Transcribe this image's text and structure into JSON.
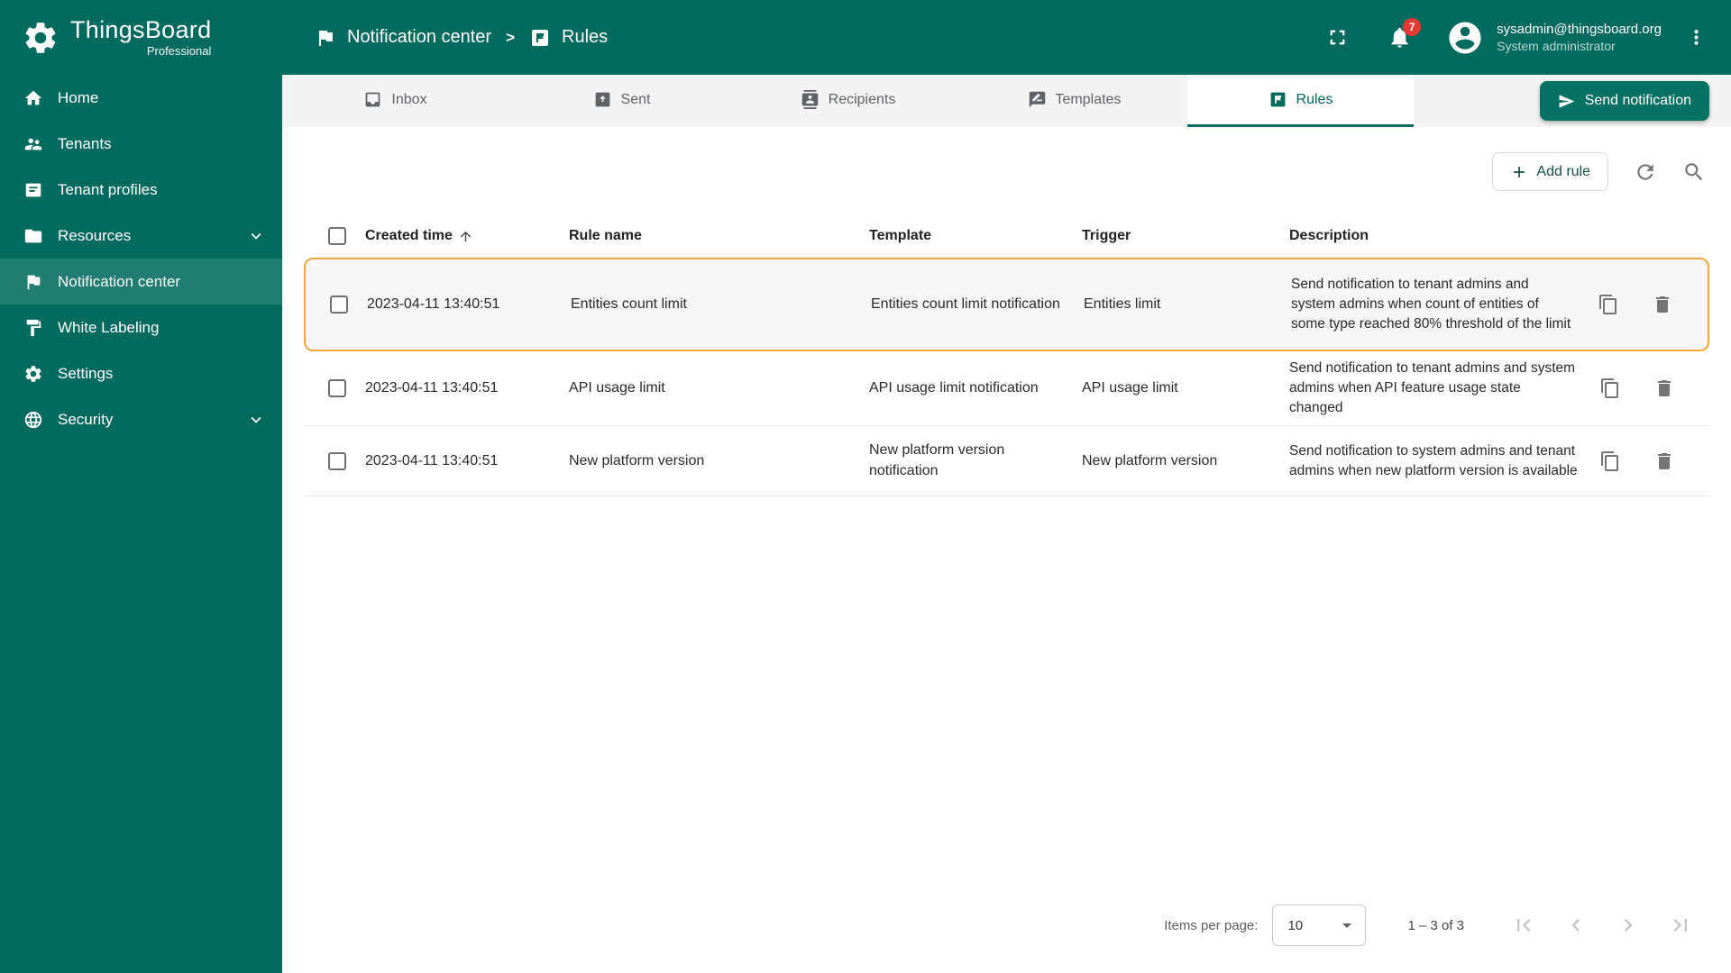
{
  "colors": {
    "primary": "#036a5e",
    "primary_light": "#077263",
    "highlight": "#f2a73b",
    "badge_red": "#e53935"
  },
  "brand": {
    "name": "ThingsBoard",
    "edition": "Professional"
  },
  "sidebar": {
    "items": [
      {
        "label": "Home",
        "icon": "home-icon"
      },
      {
        "label": "Tenants",
        "icon": "people-icon"
      },
      {
        "label": "Tenant profiles",
        "icon": "badge-icon"
      },
      {
        "label": "Resources",
        "icon": "folder-icon",
        "expandable": true
      },
      {
        "label": "Notification center",
        "icon": "notification-flag-icon",
        "active": true
      },
      {
        "label": "White Labeling",
        "icon": "format-paint-icon"
      },
      {
        "label": "Settings",
        "icon": "gear-icon"
      },
      {
        "label": "Security",
        "icon": "globe-icon",
        "expandable": true
      }
    ]
  },
  "header": {
    "breadcrumb": [
      {
        "label": "Notification center",
        "icon": "notification-flag-icon"
      },
      {
        "label": "Rules",
        "icon": "rules-icon"
      }
    ],
    "separator": ">",
    "notifications_badge": "7",
    "user": {
      "email": "sysadmin@thingsboard.org",
      "role": "System administrator"
    }
  },
  "tabs": {
    "items": [
      {
        "label": "Inbox",
        "icon": "inbox-icon"
      },
      {
        "label": "Sent",
        "icon": "sent-icon"
      },
      {
        "label": "Recipients",
        "icon": "recipients-icon"
      },
      {
        "label": "Templates",
        "icon": "templates-icon"
      },
      {
        "label": "Rules",
        "icon": "rules-icon",
        "active": true
      }
    ]
  },
  "buttons": {
    "send_notification": "Send notification",
    "add_rule": "Add rule"
  },
  "table": {
    "headers": {
      "created_time": "Created time",
      "rule_name": "Rule name",
      "template": "Template",
      "trigger": "Trigger",
      "description": "Description"
    },
    "sort": {
      "column": "Created time",
      "direction": "asc"
    },
    "rows": [
      {
        "created_time": "2023-04-11 13:40:51",
        "rule_name": "Entities count limit",
        "template": "Entities count limit notification",
        "trigger": "Entities limit",
        "description": "Send notification to tenant admins and system admins when count of entities of some type reached 80% threshold of the limit",
        "highlighted": true
      },
      {
        "created_time": "2023-04-11 13:40:51",
        "rule_name": "API usage limit",
        "template": "API usage limit notification",
        "trigger": "API usage limit",
        "description": "Send notification to tenant admins and system admins when API feature usage state changed",
        "highlighted": false
      },
      {
        "created_time": "2023-04-11 13:40:51",
        "rule_name": "New platform version",
        "template": "New platform version notification",
        "trigger": "New platform version",
        "description": "Send notification to system admins and tenant admins when new platform version is available",
        "highlighted": false
      }
    ]
  },
  "pagination": {
    "items_per_page_label": "Items per page:",
    "page_size": "10",
    "range": "1 – 3 of 3"
  }
}
